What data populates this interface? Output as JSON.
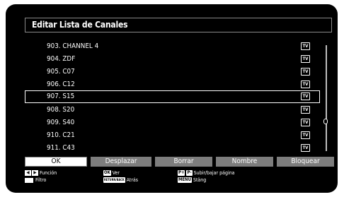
{
  "window": {
    "title": "Editar Lista de Canales"
  },
  "channels": [
    {
      "label": "903. CHANNEL 4",
      "type": "TV"
    },
    {
      "label": "904. ZDF",
      "type": "TV"
    },
    {
      "label": "905. C07",
      "type": "TV"
    },
    {
      "label": "906. C12",
      "type": "TV"
    },
    {
      "label": "907. S15",
      "type": "TV",
      "selected": true
    },
    {
      "label": "908. S20",
      "type": "TV"
    },
    {
      "label": "909. S40",
      "type": "TV"
    },
    {
      "label": "910. C21",
      "type": "TV"
    },
    {
      "label": "911. C43",
      "type": "TV"
    }
  ],
  "buttons": {
    "ok": "OK",
    "move": "Desplazar",
    "delete": "Borrar",
    "name": "Nombre",
    "lock": "Bloquear"
  },
  "help": {
    "function_label": "Función",
    "filter_label": "Filtro",
    "ok_key": "OK",
    "ok_label": "Ver",
    "return_key": "RETURN/BACK",
    "return_label": "Atrás",
    "page_key_plus": "P+",
    "page_key_minus": "P-",
    "page_label": "Subir/bajar página",
    "menu_key": "MENU",
    "menu_label": "Stäng"
  },
  "colors": {
    "background": "#000000",
    "button_inactive": "#7d7d7d",
    "button_active": "#ffffff"
  }
}
